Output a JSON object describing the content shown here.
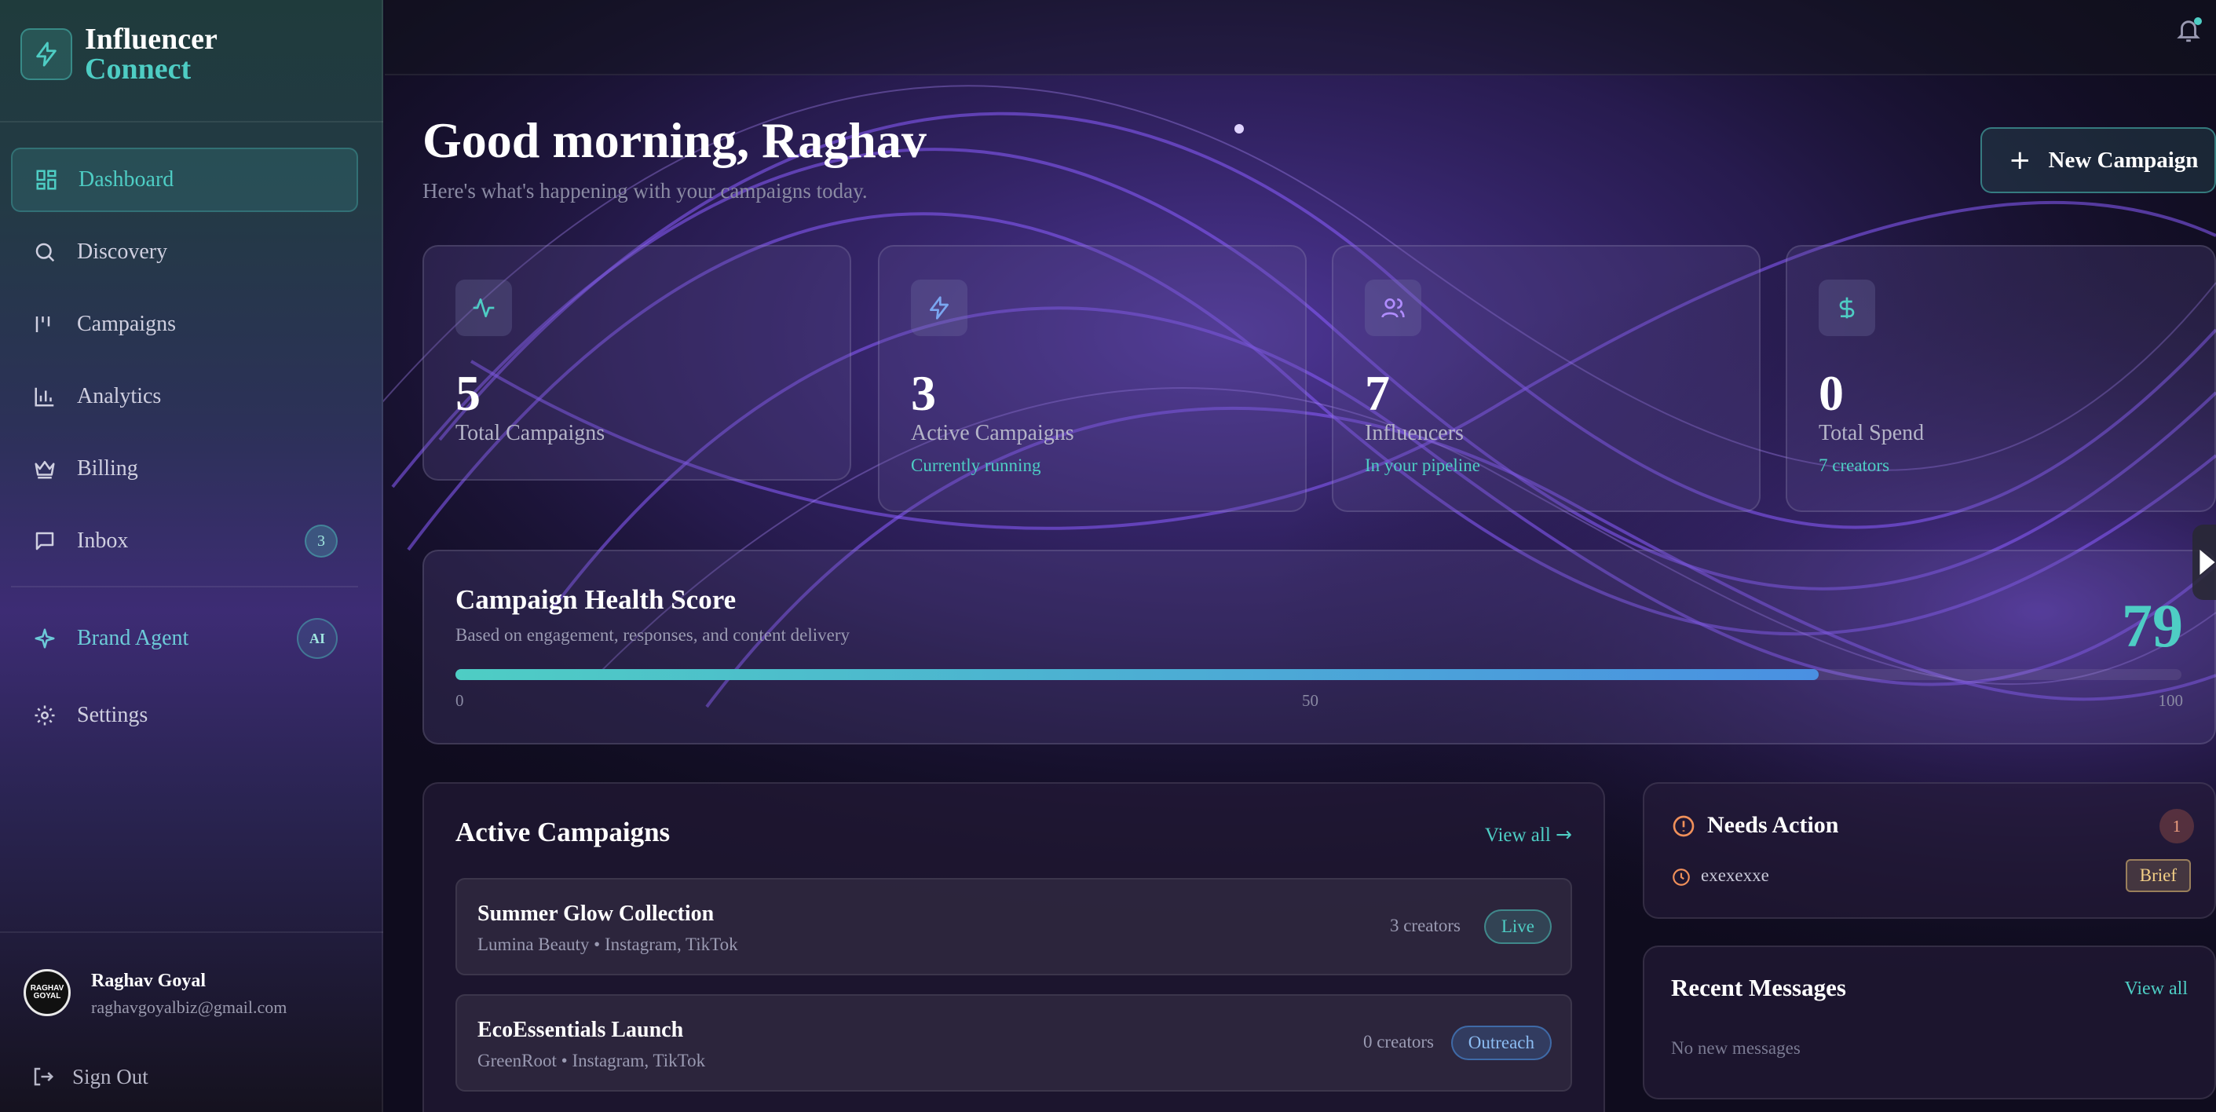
{
  "brand": {
    "line1": "Influencer",
    "line2": "Connect"
  },
  "sidebar": {
    "items": [
      {
        "label": "Dashboard",
        "icon": "dashboard-icon",
        "active": true
      },
      {
        "label": "Discovery",
        "icon": "search-icon"
      },
      {
        "label": "Campaigns",
        "icon": "campaigns-icon"
      },
      {
        "label": "Analytics",
        "icon": "bar-chart-icon"
      },
      {
        "label": "Billing",
        "icon": "crown-icon"
      },
      {
        "label": "Inbox",
        "icon": "message-icon",
        "badge": "3"
      },
      {
        "label": "Brand Agent",
        "icon": "sparkle-icon",
        "badge": "AI"
      },
      {
        "label": "Settings",
        "icon": "gear-icon"
      }
    ],
    "user": {
      "name": "Raghav Goyal",
      "email": "raghavgoyalbiz@gmail.com",
      "avatar_text": "RAGHAV GOYAL"
    },
    "sign_out": "Sign Out"
  },
  "header": {
    "greeting": "Good morning, Raghav",
    "subtitle": "Here's what's happening with your campaigns today.",
    "new_campaign": "New Campaign"
  },
  "stats": [
    {
      "value": "5",
      "label": "Total Campaigns",
      "sub": "",
      "icon": "activity-icon"
    },
    {
      "value": "3",
      "label": "Active Campaigns",
      "sub": "Currently running",
      "icon": "bolt-icon"
    },
    {
      "value": "7",
      "label": "Influencers",
      "sub": "In your pipeline",
      "icon": "users-icon"
    },
    {
      "value": "0",
      "label": "Total Spend",
      "sub": "7 creators",
      "icon": "dollar-icon"
    }
  ],
  "health": {
    "title": "Campaign Health Score",
    "subtitle": "Based on engagement, responses, and content delivery",
    "score": "79",
    "score_value": 79,
    "ticks": [
      "0",
      "50",
      "100"
    ]
  },
  "active_campaigns": {
    "title": "Active Campaigns",
    "view_all": "View all",
    "rows": [
      {
        "name": "Summer Glow Collection",
        "meta": "Lumina Beauty • Instagram, TikTok",
        "creators": "3 creators",
        "status": "Live"
      },
      {
        "name": "EcoEssentials Launch",
        "meta": "GreenRoot • Instagram, TikTok",
        "creators": "0 creators",
        "status": "Outreach"
      }
    ]
  },
  "needs_action": {
    "title": "Needs Action",
    "count": "1",
    "items": [
      {
        "label": "exexexxe",
        "tag": "Brief"
      }
    ]
  },
  "recent_messages": {
    "title": "Recent Messages",
    "view_all": "View all",
    "empty": "No new messages"
  },
  "colors": {
    "accent": "#4ecdc4",
    "blue": "#4a90e2",
    "purple": "#7b4fe0"
  }
}
